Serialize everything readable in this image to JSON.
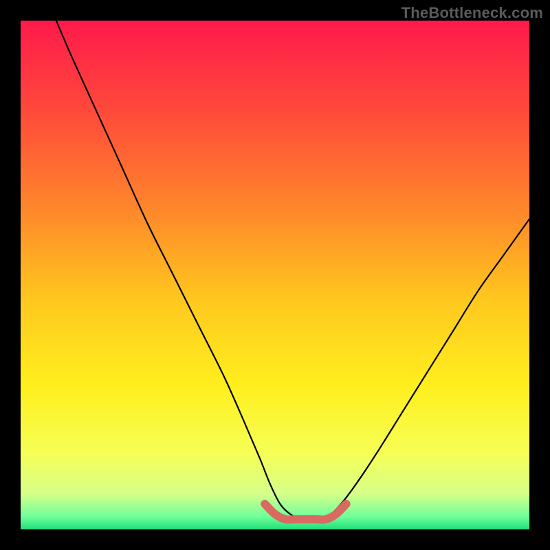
{
  "watermark": "TheBottleneck.com",
  "colors": {
    "gradient_stops": [
      {
        "offset": 0.0,
        "color": "#ff1a4b"
      },
      {
        "offset": 0.18,
        "color": "#ff4a3a"
      },
      {
        "offset": 0.38,
        "color": "#ff8a2a"
      },
      {
        "offset": 0.55,
        "color": "#ffc81e"
      },
      {
        "offset": 0.72,
        "color": "#ffef1e"
      },
      {
        "offset": 0.85,
        "color": "#f6ff55"
      },
      {
        "offset": 0.93,
        "color": "#d6ff8a"
      },
      {
        "offset": 0.975,
        "color": "#6fff9a"
      },
      {
        "offset": 1.0,
        "color": "#20e07a"
      }
    ],
    "curve": "#000000",
    "highlight": "#d86a62"
  },
  "chart_data": {
    "type": "line",
    "title": "",
    "xlabel": "",
    "ylabel": "",
    "xlim": [
      0,
      100
    ],
    "ylim": [
      0,
      100
    ],
    "series": [
      {
        "name": "curve",
        "x": [
          7,
          10,
          15,
          20,
          25,
          30,
          35,
          40,
          44,
          47,
          49,
          51,
          53,
          55,
          57,
          59,
          61,
          63,
          66,
          70,
          75,
          80,
          85,
          90,
          95,
          100
        ],
        "y": [
          100,
          93,
          82,
          71,
          60,
          50,
          40,
          30,
          21,
          14,
          9,
          5,
          3,
          2,
          2,
          2,
          3,
          5,
          9,
          15,
          23,
          31,
          39,
          47,
          54,
          61
        ]
      },
      {
        "name": "good-zone",
        "x": [
          48,
          50,
          52,
          54,
          56,
          58,
          60,
          62,
          64
        ],
        "y": [
          5,
          3,
          2,
          2,
          2,
          2,
          2,
          3,
          5
        ]
      }
    ]
  }
}
